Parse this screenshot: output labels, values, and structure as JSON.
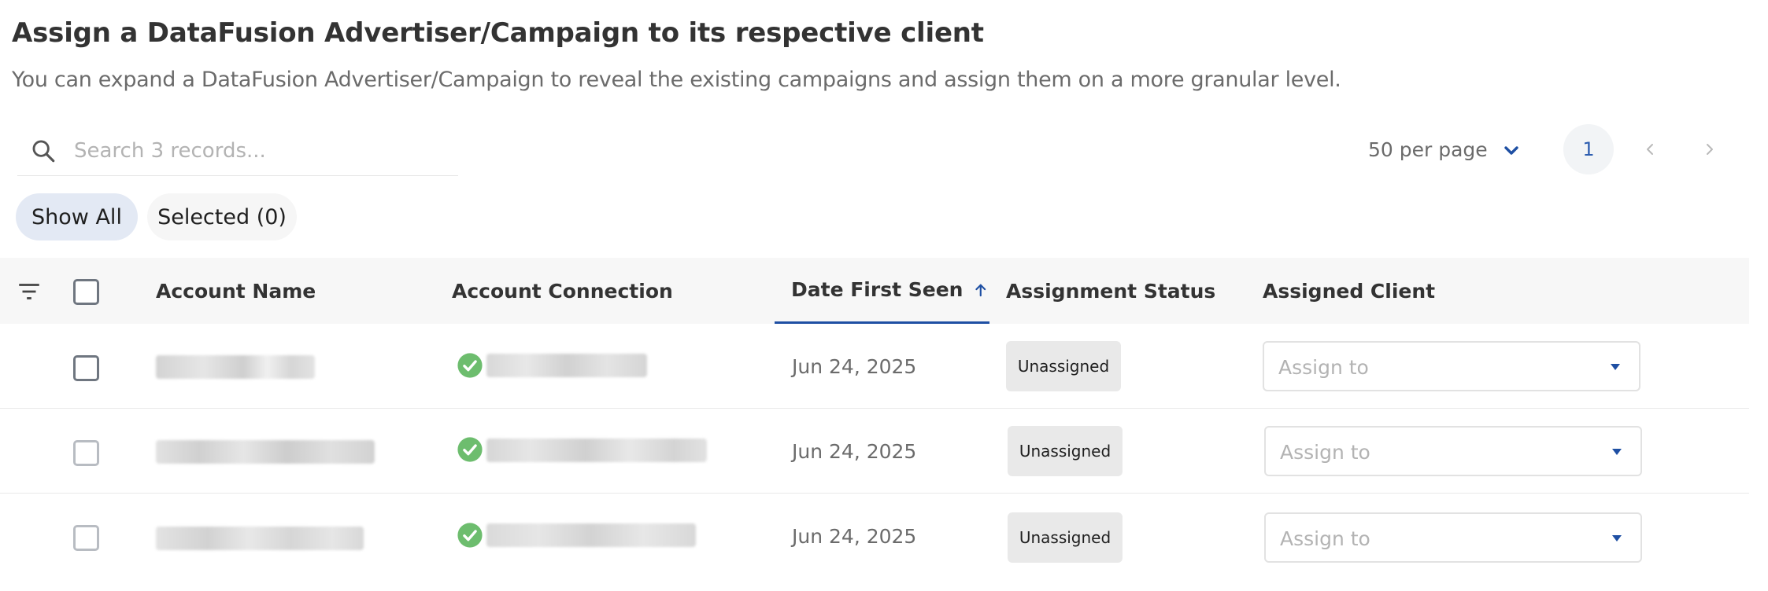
{
  "header": {
    "title": "Assign a DataFusion Advertiser/Campaign to its respective client",
    "subtitle": "You can expand a DataFusion Advertiser/Campaign to reveal the existing campaigns and assign them on a more granular level."
  },
  "search": {
    "placeholder": "Search 3 records...",
    "value": ""
  },
  "pagination": {
    "per_page_label": "50 per page",
    "current_page": "1"
  },
  "filters": {
    "show_all": "Show All",
    "selected": "Selected (0)"
  },
  "table": {
    "columns": {
      "account_name": "Account Name",
      "account_connection": "Account Connection",
      "date_first_seen": "Date First Seen",
      "assignment_status": "Assignment Status",
      "assigned_client": "Assigned Client"
    },
    "sorted_column": "Date First Seen",
    "sort_direction": "ascending",
    "rows": [
      {
        "date": "Jun 24, 2025",
        "status": "Unassigned",
        "client_placeholder": "Assign to",
        "connected": true
      },
      {
        "date": "Jun 24, 2025",
        "status": "Unassigned",
        "client_placeholder": "Assign to",
        "connected": true
      },
      {
        "date": "Jun 24, 2025",
        "status": "Unassigned",
        "client_placeholder": "Assign to",
        "connected": true
      }
    ]
  },
  "colors": {
    "accent": "#1e4fa3",
    "success": "#6dbd6e",
    "chip_active": "#e3e9f4",
    "header_bg": "#f7f7f7"
  },
  "icons": {
    "search": "search-icon",
    "filter": "filter-icon",
    "sort": "arrow-up-icon",
    "connection": "check-circle-icon",
    "dropdown": "caret-down-icon"
  }
}
